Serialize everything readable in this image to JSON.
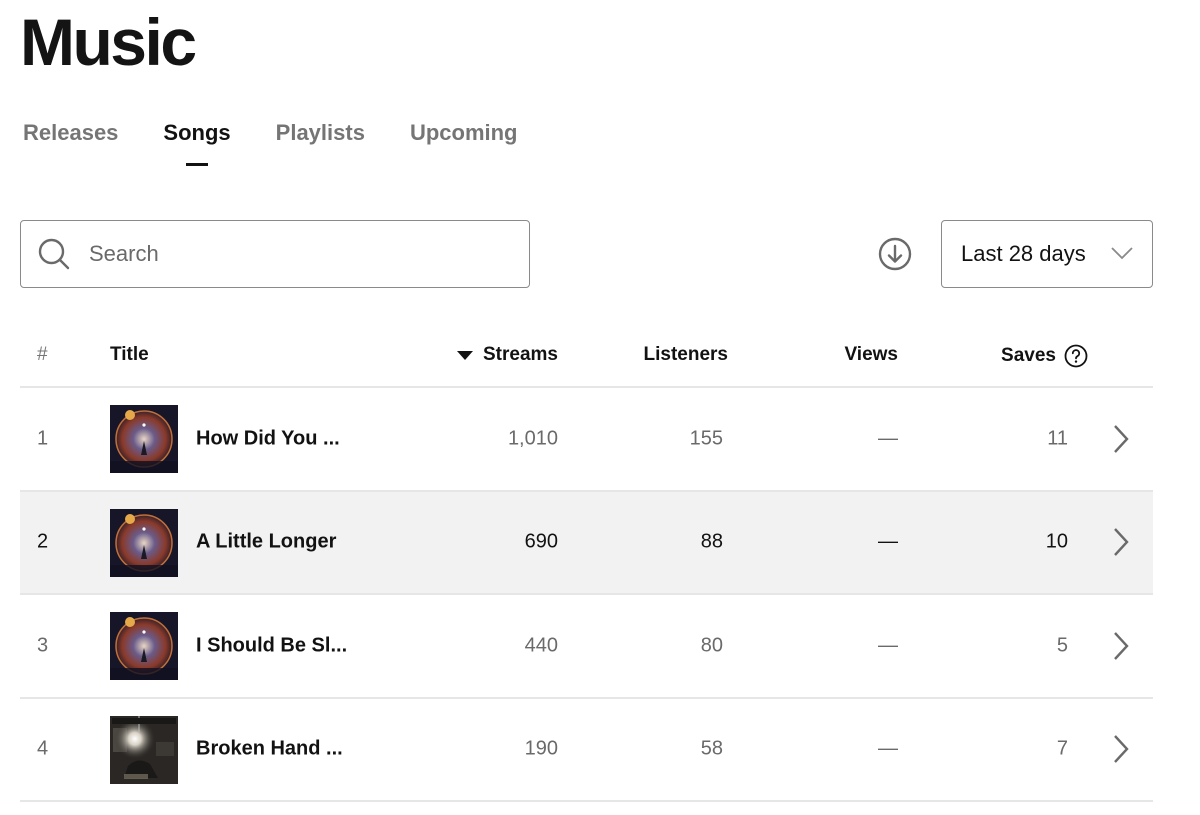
{
  "header": {
    "title": "Music"
  },
  "tabs": [
    {
      "label": "Releases",
      "active": false
    },
    {
      "label": "Songs",
      "active": true
    },
    {
      "label": "Playlists",
      "active": false
    },
    {
      "label": "Upcoming",
      "active": false
    }
  ],
  "toolbar": {
    "search_placeholder": "Search",
    "search_value": "",
    "download_icon": "download-circle-icon",
    "date_range": {
      "selected": "Last 28 days",
      "icon": "chevron-down-icon"
    }
  },
  "table": {
    "columns": {
      "num": "#",
      "title": "Title",
      "streams": "Streams",
      "listeners": "Listeners",
      "views": "Views",
      "saves": "Saves"
    },
    "sort": {
      "column": "Streams",
      "direction": "descending"
    },
    "rows": [
      {
        "num": "1",
        "title": "How Did You ...",
        "streams": "1,010",
        "listeners": "155",
        "views": "—",
        "saves": "11",
        "cover": "cosmic-portal-art"
      },
      {
        "num": "2",
        "title": "A Little Longer",
        "streams": "690",
        "listeners": "88",
        "views": "—",
        "saves": "10",
        "cover": "cosmic-portal-art",
        "highlighted": true
      },
      {
        "num": "3",
        "title": "I Should Be Sl...",
        "streams": "440",
        "listeners": "80",
        "views": "—",
        "saves": "5",
        "cover": "cosmic-portal-art"
      },
      {
        "num": "4",
        "title": "Broken Hand ...",
        "streams": "190",
        "listeners": "58",
        "views": "—",
        "saves": "7",
        "cover": "lightbulb-room-art"
      }
    ]
  }
}
